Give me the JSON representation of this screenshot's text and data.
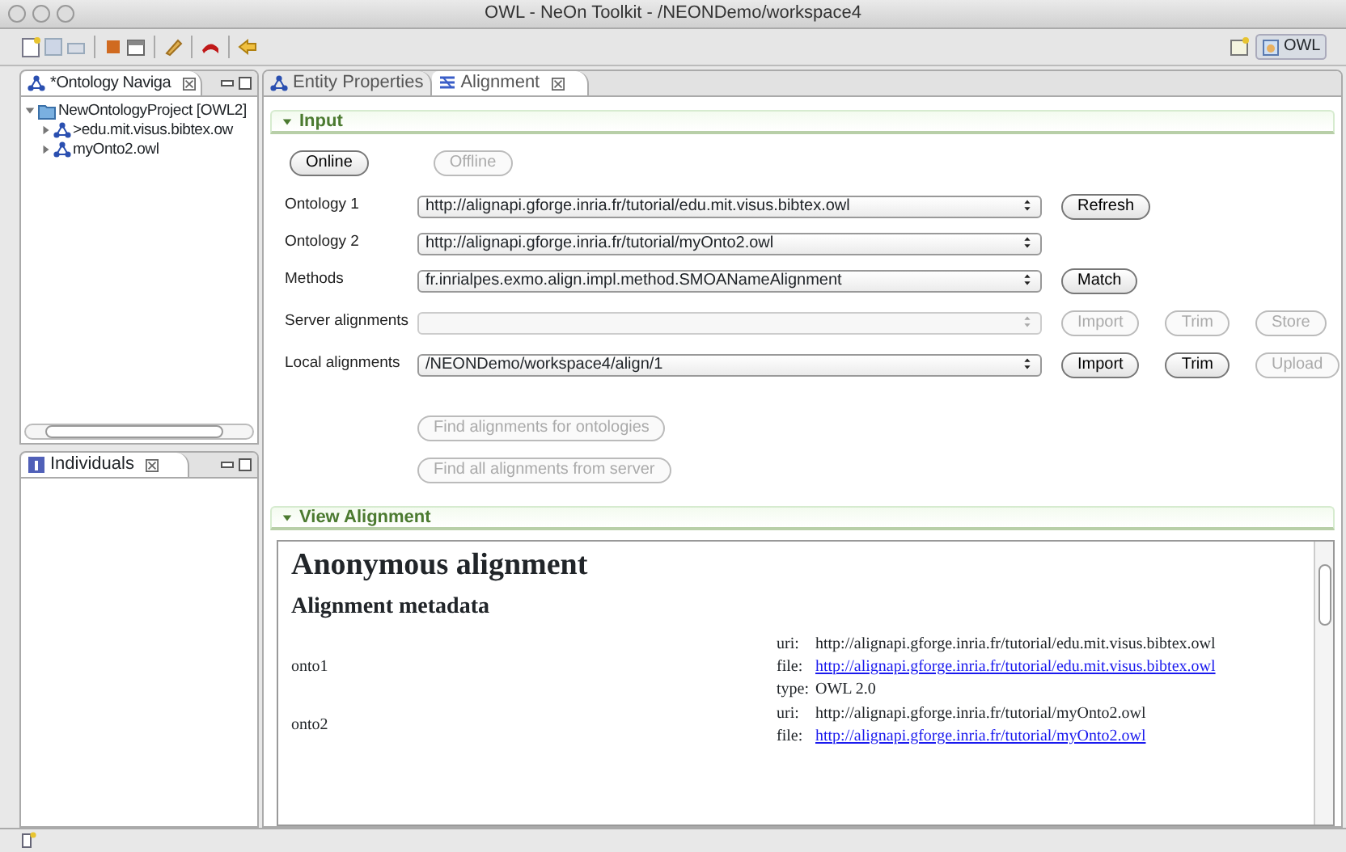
{
  "window": {
    "title": "OWL - NeOn Toolkit - /NEONDemo/workspace4"
  },
  "perspective": {
    "label": "OWL",
    "selected": true
  },
  "navigator": {
    "title": "*Ontology Naviga",
    "tree": [
      {
        "label": "NewOntologyProject [OWL2]",
        "kind": "project",
        "expanded": true,
        "children": [
          {
            "label": ">edu.mit.visus.bibtex.ow",
            "kind": "ontology",
            "expanded": false
          },
          {
            "label": "myOnto2.owl",
            "kind": "ontology",
            "expanded": false
          }
        ]
      }
    ]
  },
  "individuals": {
    "title": "Individuals"
  },
  "editor_tabs": [
    {
      "label": "Entity Properties",
      "selected": false
    },
    {
      "label": "Alignment",
      "selected": true
    }
  ],
  "input": {
    "title": "Input",
    "expanded": true,
    "mode_buttons": [
      {
        "label": "Online",
        "disabled": false
      },
      {
        "label": "Offline",
        "disabled": true
      }
    ],
    "rows": [
      {
        "label": "Ontology 1",
        "value": "http://alignapi.gforge.inria.fr/tutorial/edu.mit.visus.bibtex.owl",
        "disabled": false,
        "buttons": [
          {
            "label": "Refresh",
            "disabled": false
          }
        ]
      },
      {
        "label": "Ontology 2",
        "value": "http://alignapi.gforge.inria.fr/tutorial/myOnto2.owl",
        "disabled": false,
        "buttons": []
      },
      {
        "label": "Methods",
        "value": "fr.inrialpes.exmo.align.impl.method.SMOANameAlignment",
        "disabled": false,
        "buttons": [
          {
            "label": "Match",
            "disabled": false
          }
        ]
      },
      {
        "label": "Server alignments",
        "disabled": true,
        "buttons": [
          {
            "label": "Import",
            "disabled": true
          },
          {
            "label": "Trim",
            "disabled": true
          },
          {
            "label": "Store",
            "disabled": true
          }
        ]
      },
      {
        "label": "Local alignments",
        "value": "/NEONDemo/workspace4/align/1",
        "disabled": false,
        "buttons": [
          {
            "label": "Import",
            "disabled": false
          },
          {
            "label": "Trim",
            "disabled": false
          },
          {
            "label": "Upload",
            "disabled": true
          }
        ]
      }
    ],
    "find_buttons": [
      {
        "label": "Find alignments for ontologies",
        "disabled": true
      },
      {
        "label": "Find all alignments from server",
        "disabled": true
      }
    ]
  },
  "view": {
    "title": "View Alignment",
    "expanded": true,
    "heading": "Anonymous alignment",
    "subheading": "Alignment metadata",
    "metadata": [
      {
        "name": "onto1",
        "fields": [
          {
            "key": "uri:",
            "value": "http://alignapi.gforge.inria.fr/tutorial/edu.mit.visus.bibtex.owl",
            "link": false
          },
          {
            "key": "file:",
            "value": "http://alignapi.gforge.inria.fr/tutorial/edu.mit.visus.bibtex.owl",
            "link": true
          },
          {
            "key": "type:",
            "value": "OWL 2.0",
            "link": false
          }
        ]
      },
      {
        "name": "onto2",
        "fields": [
          {
            "key": "uri:",
            "value": "http://alignapi.gforge.inria.fr/tutorial/myOnto2.owl",
            "link": false
          },
          {
            "key": "file:",
            "value": "http://alignapi.gforge.inria.fr/tutorial/myOnto2.owl",
            "link": true
          }
        ]
      }
    ]
  }
}
